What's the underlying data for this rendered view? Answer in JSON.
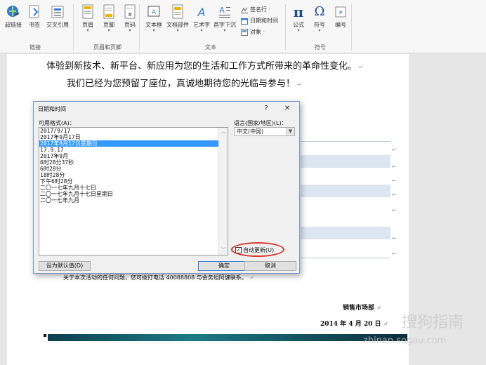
{
  "ribbon": {
    "buttons": [
      {
        "label": "超链接",
        "icon": "hyperlink-icon"
      },
      {
        "label": "书签",
        "icon": "bookmark-icon"
      },
      {
        "label": "交叉引用",
        "icon": "cross-reference-icon"
      },
      {
        "label": "页眉",
        "icon": "header-icon"
      },
      {
        "label": "页脚",
        "icon": "footer-icon"
      },
      {
        "label": "页码",
        "icon": "page-number-icon"
      },
      {
        "label": "文本框",
        "icon": "textbox-icon"
      },
      {
        "label": "文档部件",
        "icon": "quick-parts-icon"
      },
      {
        "label": "艺术字",
        "icon": "wordart-icon"
      },
      {
        "label": "首字下沉",
        "icon": "drop-cap-icon"
      },
      {
        "label": "公式",
        "icon": "pi-icon",
        "glyph": "π"
      },
      {
        "label": "符号",
        "icon": "omega-icon",
        "glyph": "Ω"
      },
      {
        "label": "编号",
        "icon": "numbering-icon"
      }
    ],
    "small_items": [
      {
        "label": "签名行 ·",
        "icon": "signature-line-icon"
      },
      {
        "label": "日期和时间",
        "icon": "date-time-icon"
      },
      {
        "label": "对象 ·",
        "icon": "object-icon"
      }
    ],
    "groups": [
      "链接",
      "页眉和页脚",
      "文本",
      "符号"
    ]
  },
  "document": {
    "line1": "体验到新技术、新平台、新应用为您的生活和工作方式所带来的革命性变化。",
    "line2": "我们已经为您预留了座位，真诚地期待您的光临与参与！",
    "contact": "关于本次活动的任何问题，您可拨打电话 40088808 与会务组阿健联系。",
    "signature": "销售市场部",
    "date": "2014 年 4 月 20 日",
    "para_mark": "↵"
  },
  "dialog": {
    "title": "日期和时间",
    "help": "?",
    "close": "✕",
    "formats_label": "可用格式(A)：",
    "formats": [
      "2017/9/17",
      "2017年9月17日",
      "2017年9月17日星期日",
      "17.9.17",
      "2017年9月",
      "6时28分37秒",
      "6时28分",
      "18时28分",
      "下午6时28分",
      "二〇一七年九月十七日",
      "二〇一七年九月十七日星期日",
      "二〇一七年九月"
    ],
    "selected_index": 2,
    "language_label": "语言(国家/地区)(L)：",
    "language_value": "中文(中国)",
    "auto_update_label": "自动更新(U)",
    "auto_update_checked": true,
    "set_default_label": "设为默认值(D)",
    "ok_label": "确定",
    "cancel_label": "取消"
  },
  "watermark": {
    "big": "搜狗指南",
    "small": "zhinan.sogou.com"
  }
}
